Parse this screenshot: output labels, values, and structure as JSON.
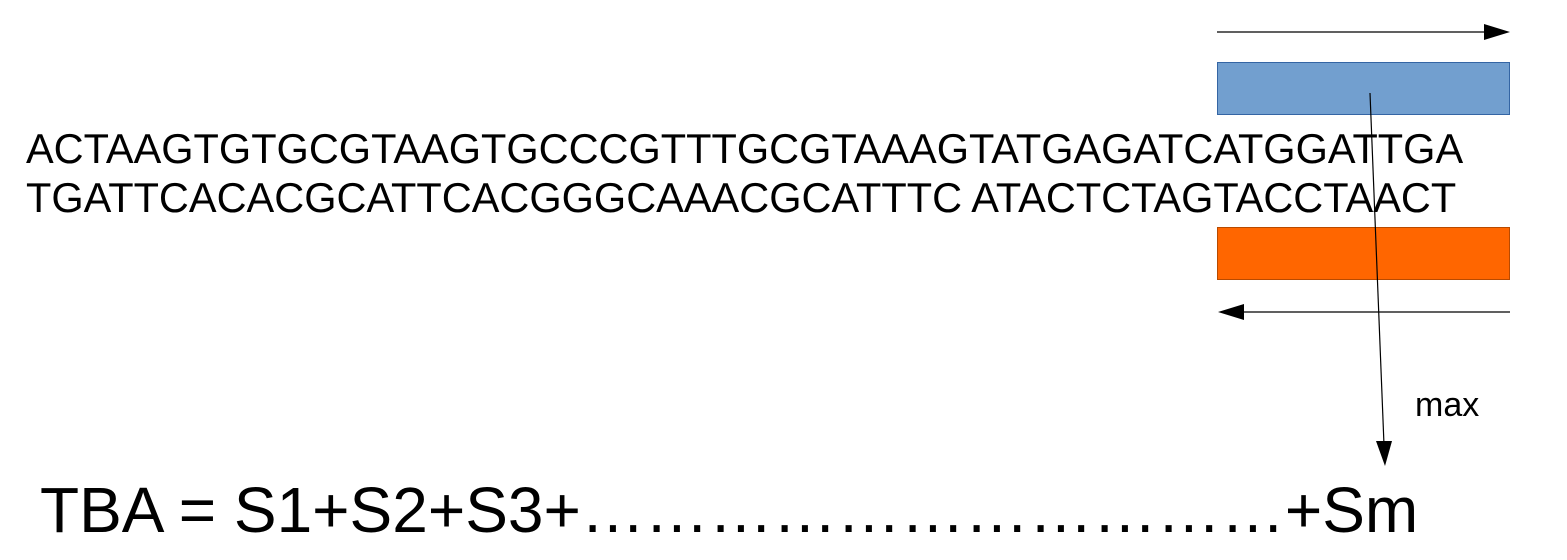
{
  "sequence": {
    "top_strand": "ACTAAGTGTGCGTAAGTGCCCGTTTGCGTAAAGTATGAGATCATGGATTGA",
    "bottom_strand": "TGATTCACACGCATTCACGGGCAAACGCATTTC ATACTCTAGTACCTAACT"
  },
  "windows": {
    "forward_color": "#729fcf",
    "reverse_color": "#ff6600"
  },
  "annotation": {
    "max_label": "max"
  },
  "formula": {
    "text": "TBA = S1+S2+S3+……………………………+Sm"
  }
}
